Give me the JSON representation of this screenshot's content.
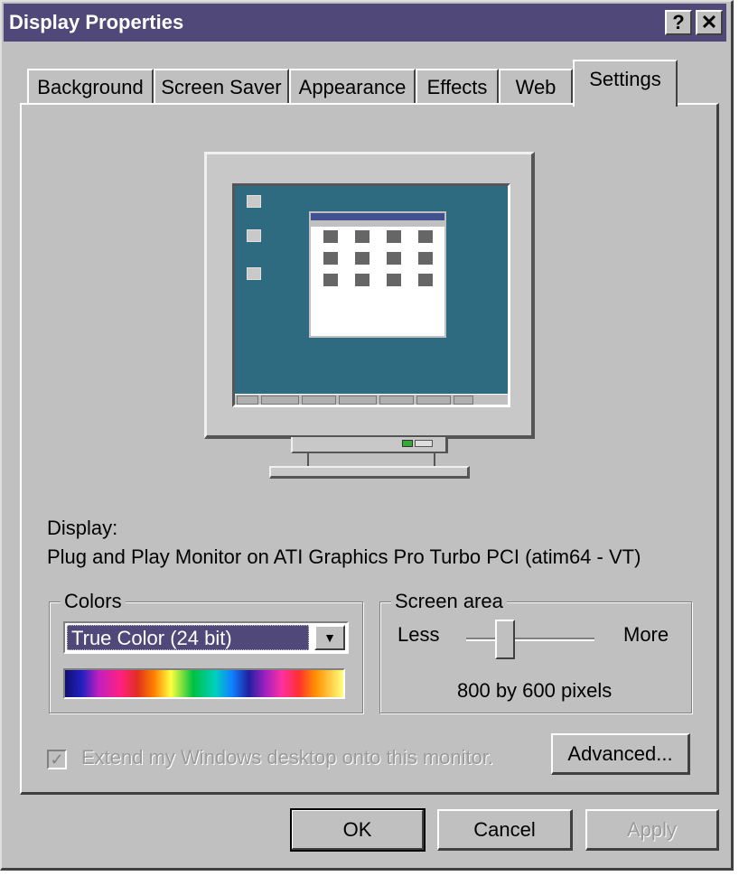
{
  "window": {
    "title": "Display Properties",
    "help_button": "?",
    "close_button": "✕"
  },
  "tabs": [
    {
      "label": "Background"
    },
    {
      "label": "Screen Saver"
    },
    {
      "label": "Appearance"
    },
    {
      "label": "Effects"
    },
    {
      "label": "Web"
    },
    {
      "label": "Settings",
      "active": true
    }
  ],
  "display": {
    "label": "Display:",
    "device": "Plug and Play Monitor on ATI Graphics Pro Turbo PCI (atim64 - VT)"
  },
  "colors": {
    "group_label": "Colors",
    "selected_value": "True Color (24 bit)"
  },
  "screen_area": {
    "group_label": "Screen area",
    "less_label": "Less",
    "more_label": "More",
    "value_text": "800 by 600 pixels",
    "slider_level": 0.3
  },
  "extend_checkbox": {
    "label": "Extend my Windows desktop onto this monitor.",
    "checked": true,
    "enabled": false
  },
  "buttons": {
    "advanced": "Advanced...",
    "ok": "OK",
    "cancel": "Cancel",
    "apply": "Apply"
  },
  "colors_theme": {
    "titlebar": "#504878",
    "face": "#c0c0c0",
    "desktop": "#2f6b80"
  }
}
